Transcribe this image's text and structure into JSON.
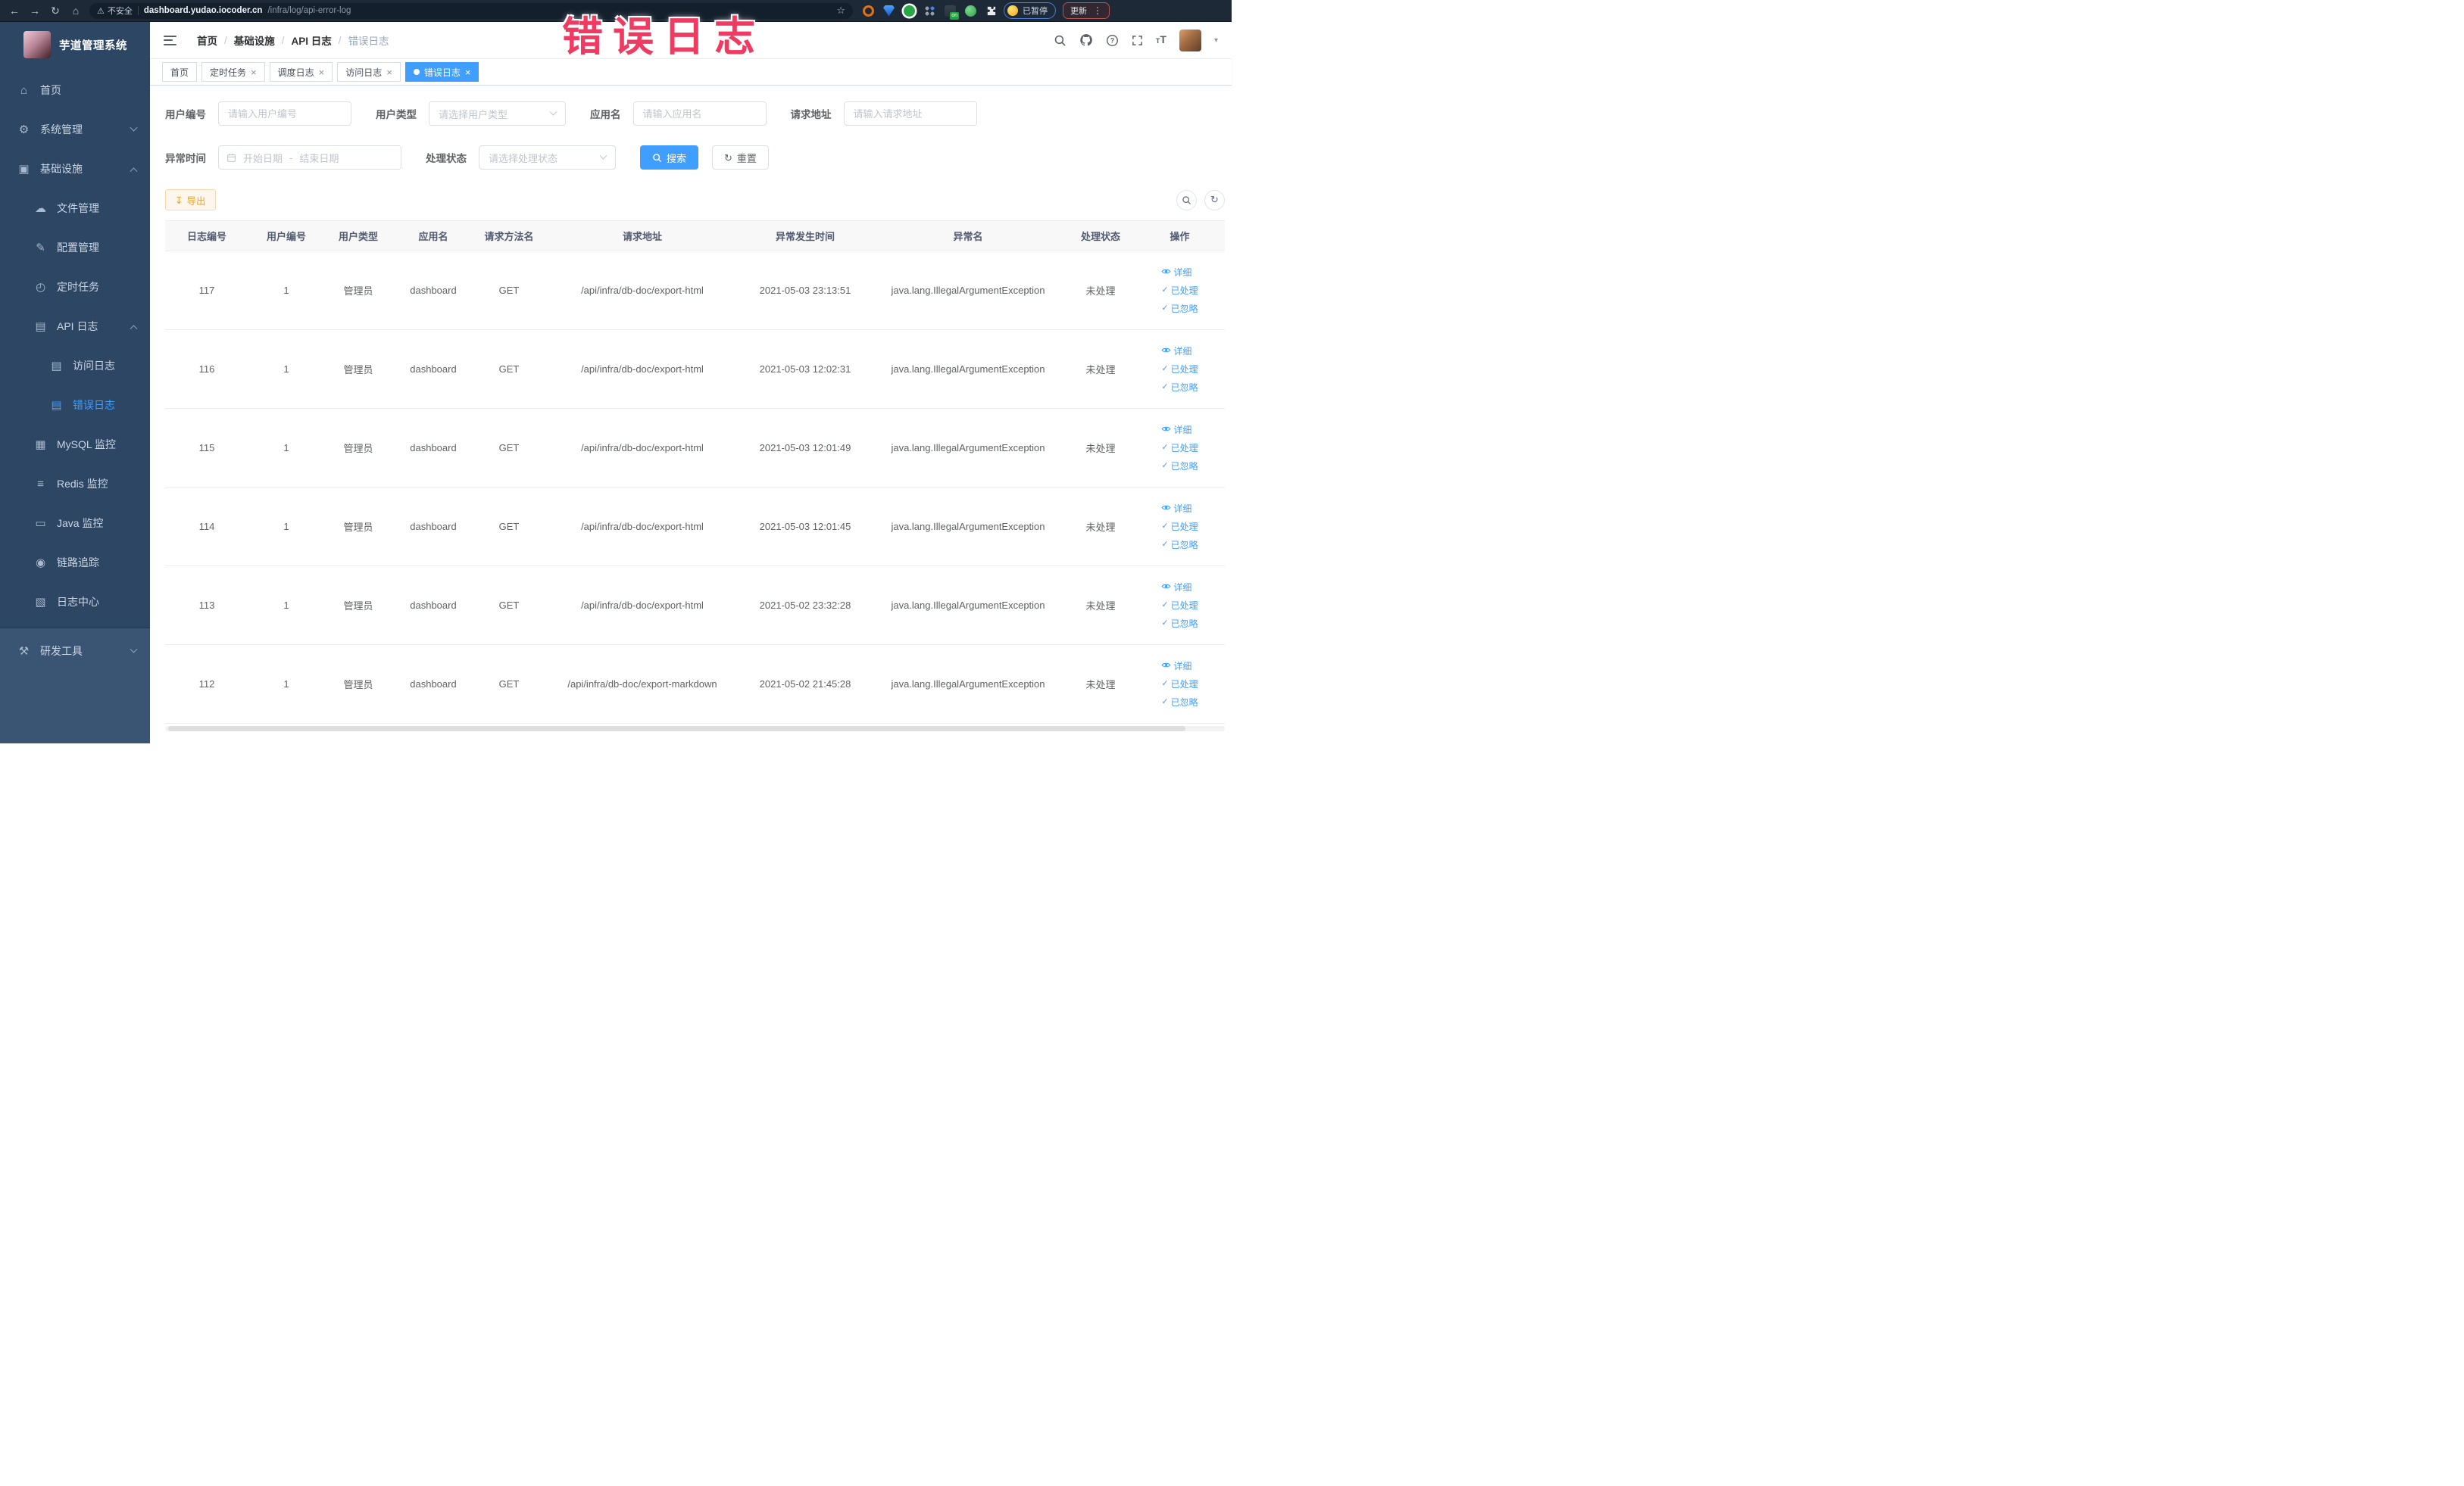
{
  "theme": {
    "accent": "#409eff",
    "warning": "#e6a23c",
    "sidebar_bg": "#2c4663",
    "sidebar_bottom_bg": "#3a5474",
    "overlay_pink": "#ef3a61",
    "browser_bar_bg": "#1d2936"
  },
  "overlay_title": "错误日志",
  "browser": {
    "security_label": "不安全",
    "url_host": "dashboard.yudao.iocoder.cn",
    "url_path": "/infra/log/api-error-log",
    "paused_label": "已暂停",
    "update_label": "更新"
  },
  "sidebar": {
    "app_title": "芋道管理系统",
    "items": [
      {
        "label": "首页",
        "icon": "home-icon",
        "depth": 1
      },
      {
        "label": "系统管理",
        "icon": "gear-icon",
        "depth": 1,
        "chevron": "down"
      },
      {
        "label": "基础设施",
        "icon": "infrastructure-icon",
        "depth": 1,
        "chevron": "up"
      },
      {
        "label": "文件管理",
        "icon": "file-manage-icon",
        "depth": 2
      },
      {
        "label": "配置管理",
        "icon": "config-manage-icon",
        "depth": 2
      },
      {
        "label": "定时任务",
        "icon": "schedule-job-icon",
        "depth": 2
      },
      {
        "label": "API 日志",
        "icon": "api-log-icon",
        "depth": 2,
        "chevron": "up"
      },
      {
        "label": "访问日志",
        "icon": "access-log-icon",
        "depth": 3
      },
      {
        "label": "错误日志",
        "icon": "error-log-icon",
        "depth": 3,
        "active": true
      },
      {
        "label": "MySQL 监控",
        "icon": "mysql-monitor-icon",
        "depth": 2
      },
      {
        "label": "Redis 监控",
        "icon": "redis-monitor-icon",
        "depth": 2
      },
      {
        "label": "Java 监控",
        "icon": "java-monitor-icon",
        "depth": 2
      },
      {
        "label": "链路追踪",
        "icon": "trace-icon",
        "depth": 2
      },
      {
        "label": "日志中心",
        "icon": "log-center-icon",
        "depth": 2
      },
      {
        "label": "研发工具",
        "icon": "dev-tools-icon",
        "depth": 1,
        "chevron": "down",
        "section": "bottom"
      }
    ]
  },
  "header": {
    "breadcrumb": [
      "首页",
      "基础设施",
      "API 日志",
      "错误日志"
    ]
  },
  "tags": [
    {
      "label": "首页",
      "closable": false,
      "active": false
    },
    {
      "label": "定时任务",
      "closable": true,
      "active": false
    },
    {
      "label": "调度日志",
      "closable": true,
      "active": false
    },
    {
      "label": "访问日志",
      "closable": true,
      "active": false
    },
    {
      "label": "错误日志",
      "closable": true,
      "active": true
    }
  ],
  "filters": {
    "user_id": {
      "label": "用户编号",
      "placeholder": "请输入用户编号"
    },
    "user_type": {
      "label": "用户类型",
      "placeholder": "请选择用户类型"
    },
    "app_name": {
      "label": "应用名",
      "placeholder": "请输入应用名"
    },
    "request_url": {
      "label": "请求地址",
      "placeholder": "请输入请求地址"
    },
    "exception_time": {
      "label": "异常时间",
      "start_placeholder": "开始日期",
      "separator": "-",
      "end_placeholder": "结束日期"
    },
    "process_status": {
      "label": "处理状态",
      "placeholder": "请选择处理状态"
    },
    "search_label": "搜索",
    "reset_label": "重置"
  },
  "toolbar": {
    "export_label": "导出"
  },
  "table": {
    "columns": [
      "日志编号",
      "用户编号",
      "用户类型",
      "应用名",
      "请求方法名",
      "请求地址",
      "异常发生时间",
      "异常名",
      "处理状态",
      "操作"
    ],
    "action_labels": [
      "详细",
      "已处理",
      "已忽略"
    ],
    "rows": [
      {
        "id": "117",
        "user_id": "1",
        "user_type": "管理员",
        "app_name": "dashboard",
        "method": "GET",
        "url": "/api/infra/db-doc/export-html",
        "time": "2021-05-03 23:13:51",
        "exception": "java.lang.IllegalArgumentException",
        "status": "未处理"
      },
      {
        "id": "116",
        "user_id": "1",
        "user_type": "管理员",
        "app_name": "dashboard",
        "method": "GET",
        "url": "/api/infra/db-doc/export-html",
        "time": "2021-05-03 12:02:31",
        "exception": "java.lang.IllegalArgumentException",
        "status": "未处理"
      },
      {
        "id": "115",
        "user_id": "1",
        "user_type": "管理员",
        "app_name": "dashboard",
        "method": "GET",
        "url": "/api/infra/db-doc/export-html",
        "time": "2021-05-03 12:01:49",
        "exception": "java.lang.IllegalArgumentException",
        "status": "未处理"
      },
      {
        "id": "114",
        "user_id": "1",
        "user_type": "管理员",
        "app_name": "dashboard",
        "method": "GET",
        "url": "/api/infra/db-doc/export-html",
        "time": "2021-05-03 12:01:45",
        "exception": "java.lang.IllegalArgumentException",
        "status": "未处理"
      },
      {
        "id": "113",
        "user_id": "1",
        "user_type": "管理员",
        "app_name": "dashboard",
        "method": "GET",
        "url": "/api/infra/db-doc/export-html",
        "time": "2021-05-02 23:32:28",
        "exception": "java.lang.IllegalArgumentException",
        "status": "未处理"
      },
      {
        "id": "112",
        "user_id": "1",
        "user_type": "管理员",
        "app_name": "dashboard",
        "method": "GET",
        "url": "/api/infra/db-doc/export-markdown",
        "time": "2021-05-02 21:45:28",
        "exception": "java.lang.IllegalArgumentException",
        "status": "未处理"
      }
    ]
  }
}
